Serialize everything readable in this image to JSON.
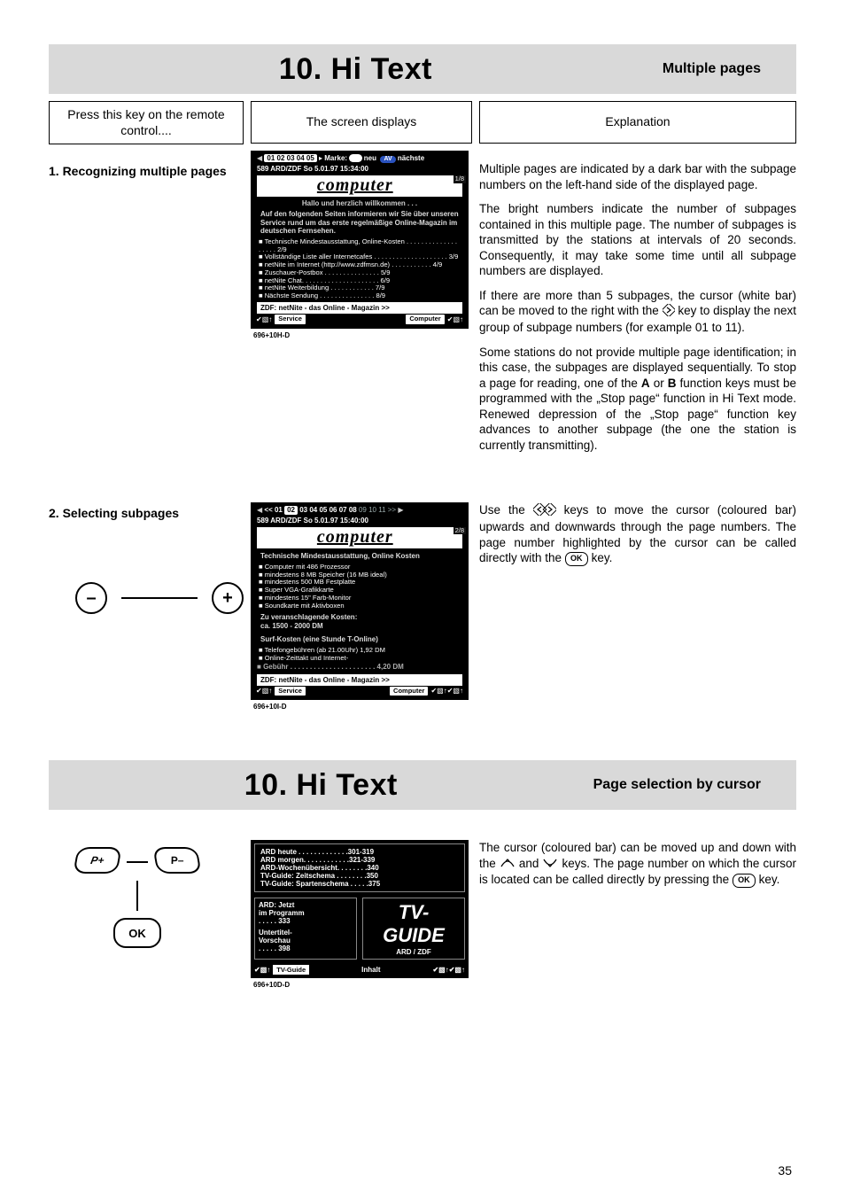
{
  "page_number": "35",
  "section1": {
    "title": "10. Hi Text",
    "subtitle": "Multiple pages",
    "col_labels": {
      "left": "Press this key on the remote control....",
      "mid": "The screen displays",
      "right": "Explanation"
    },
    "step1_label": "1. Recognizing multiple pages",
    "step2_label": "2. Selecting subpages",
    "explanation": {
      "p1": "Multiple pages are indicated by a dark bar with the subpage numbers on the left-hand side of the display­ed page.",
      "p2": "The bright numbers indicate the number of subpages contained in this multiple page. The number of sub­pages is transmitted by the stations at intervals of 20 seconds. Consequently, it may take some time until all subpage numbers are displayed.",
      "p3a": "If there are more than 5 subpages, the cursor (white bar) can be moved to the right with the ",
      "p3b": " key to dis­play the next group of subpage numbers (for example 01 to 11).",
      "p4a": "Some stations do not provide multiple page identifica­tion; in this case, the subpages are displayed sequen­tially. To stop a page for reading, one of the ",
      "p4_A": "A",
      "p4_mid": " or ",
      "p4_B": "B",
      "p4b": " function keys must be programmed with the „Stop page“ function in Hi Text mode. Renewed depression of the „Stop page“ function key advances to another subpage (the one the station is currently transmitting)."
    },
    "explanation2": {
      "p1a": "Use the ",
      "p1b": " keys to move the cursor (coloured bar) upwards and downwards through the page numbers. The page number highlighted by the cursor can be called directly with the ",
      "p1c": " key."
    },
    "ttx1": {
      "subbar": {
        "nums": "01  02  03  04  05",
        "label_marke": "Marke:",
        "tag_neu": "neu",
        "tag_av": "AV",
        "label_next": "nächste"
      },
      "header": "589   ARD/ZDF    So 5.01.97    15:34:00",
      "corner": "1/8",
      "banner": "computer",
      "greet": "Hallo und herzlich willkommen . . .",
      "intro": "Auf den folgenden Seiten informieren wir Sie über unseren Service rund um das erste regelmäßige Online-Magazin im deutschen Fernsehen.",
      "items": [
        "Technische Mindestausstattung, Online-Kosten . . . . . . . . . . . . . . . . . . . 2/9",
        "Vollständige Liste aller Internetcafes . . . . . . . . . . . . . . . . . . . . 3/9",
        "netNite im Internet (http://www.zdfmsn.de) . . . . . . . . . . . 4/9",
        "Zuschauer-Postbox . . . . . . . . . . . . . . . 5/9",
        "netNite Chat. . . . . . . . . . . . . . . . . . . . . 6/9",
        "netNite Weiterbildung . . . . . . . . . . . . 7/9",
        "Nächste Sendung  . . . . . . . . . . . . . . . 8/9"
      ],
      "footer_line": "ZDF:  netNite  -  das Online - Magazin >>",
      "foot_service": "Service",
      "foot_computer": "Computer",
      "caption": "696+10H-D"
    },
    "ttx2": {
      "subbar_left": "<<  01",
      "subbar_hi": "02",
      "subbar_rest": "03  04  05  06  07  08",
      "subbar_dim": "09 10 11 >>",
      "header": "589   ARD/ZDF    So 5.01.97    15:40:00",
      "corner": "2/8",
      "banner": "computer",
      "title1": "Technische Mindestausstattung, Online Kosten",
      "items1": [
        "Computer mit 486 Prozessor",
        "mindestens 8 MB Speicher (16 MB ideal)",
        "mindestens 500 MB Festplatte",
        "Super VGA-Grafikkarte",
        "mindestens 15\" Farb-Monitor",
        "Soundkarte mit Aktivboxen"
      ],
      "cost_title": "Zu veranschlagende Kosten:\nca. 1500 - 2000 DM",
      "surf_title": "Surf-Kosten (eine Stunde T-Online)",
      "items2": [
        "Telefongebühren (ab 21.00Uhr)   1,92 DM",
        "Online-Zeittakt und Internet-"
      ],
      "gebuehr": "Gebühr . . . . . . . . . . . . . . . . . . . . . . 4,20 DM",
      "footer_line": "ZDF:  netNite  -  das Online - Magazin >>",
      "foot_service": "Service",
      "foot_computer": "Computer",
      "caption": "696+10I-D"
    },
    "remote_pair": {
      "minus": "–",
      "plus": "+"
    }
  },
  "section2": {
    "title": "10. Hi Text",
    "subtitle": "Page selection by cursor",
    "explanation": {
      "p1a": "The cursor (coloured bar) can be moved up and down with the ",
      "p1b": " and ",
      "p1c": " keys. The page number on which the cursor is located can be called directly by pressing the ",
      "p1d": " key."
    },
    "remote": {
      "pplus": "P+",
      "pminus": "P–",
      "ok": "OK"
    },
    "guide": {
      "list": [
        "ARD heute . . . . . . . . . . . . .301-319",
        "ARD morgen. . . . . . . . . . . .321-339",
        "ARD-Wochenübersicht. . . . . . . .340",
        "TV-Guide: Zeitschema . . . . . . . .350",
        "TV-Guide: Spartenschema . . . . .375"
      ],
      "box_left_l1": "ARD:  Jetzt",
      "box_left_l2": "im Programm",
      "box_left_l3": ". . . . .  333",
      "box_left_l4": "Untertitel-",
      "box_left_l5": "Vorschau",
      "box_left_l6": ". . . . .  398",
      "box_right_big1": "TV-",
      "box_right_big2": "GUIDE",
      "box_right_sub": "ARD  /  ZDF",
      "foot_tvguide": "TV-Guide",
      "foot_inhalt": "Inhalt",
      "caption": "696+10D-D"
    }
  }
}
